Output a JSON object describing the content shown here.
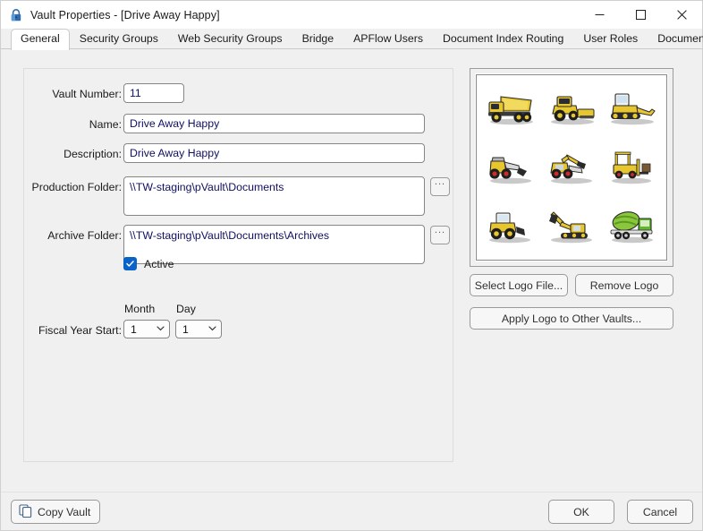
{
  "window": {
    "title": "Vault Properties - [Drive Away Happy]",
    "lock_icon": "lock-icon",
    "minimize_label": "—",
    "maximize_label": "□",
    "close_label": "✕"
  },
  "tabs": [
    {
      "label": "General",
      "active": true
    },
    {
      "label": "Security Groups",
      "active": false
    },
    {
      "label": "Web Security Groups",
      "active": false
    },
    {
      "label": "Bridge",
      "active": false
    },
    {
      "label": "APFlow Users",
      "active": false
    },
    {
      "label": "Document Index Routing",
      "active": false
    },
    {
      "label": "User Roles",
      "active": false
    },
    {
      "label": "Document Publishing",
      "active": false
    }
  ],
  "form": {
    "vault_number": {
      "label": "Vault Number:",
      "value": "11"
    },
    "name": {
      "label": "Name:",
      "value": "Drive Away Happy"
    },
    "description": {
      "label": "Description:",
      "value": "Drive Away Happy"
    },
    "production_folder": {
      "label": "Production Folder:",
      "value": "\\\\TW-staging\\pVault\\Documents",
      "browse_label": "..."
    },
    "archive_folder": {
      "label": "Archive Folder:",
      "value": "\\\\TW-staging\\pVault\\Documents\\Archives",
      "browse_label": "..."
    },
    "active": {
      "label": "Active",
      "checked": true
    },
    "fiscal_year_start": {
      "label": "Fiscal Year Start:",
      "month_header": "Month",
      "day_header": "Day",
      "month_value": "1",
      "day_value": "1"
    }
  },
  "logo_panel": {
    "alt": "construction-vehicles-logo",
    "select_logo_label": "Select Logo File...",
    "remove_logo_label": "Remove Logo",
    "apply_logo_label": "Apply Logo to Other Vaults..."
  },
  "footer": {
    "copy_vault_label": "Copy Vault",
    "copy_icon": "copy-icon",
    "ok_label": "OK",
    "cancel_label": "Cancel"
  },
  "colors": {
    "accent": "#0a64c8",
    "window_bg": "#f0f0f0",
    "field_text": "#101060",
    "border": "#868686"
  }
}
